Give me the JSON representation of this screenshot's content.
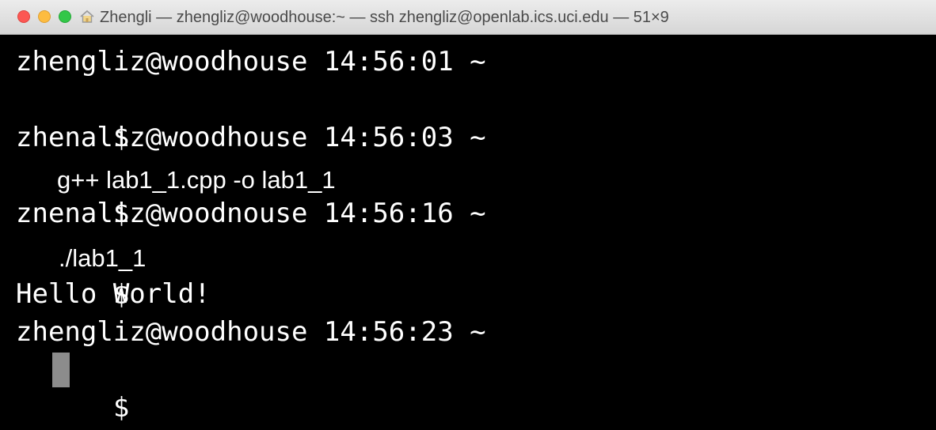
{
  "window": {
    "title": "Zhengli — zhengliz@woodhouse:~ — ssh zhengliz@openlab.ics.uci.edu — 51×9",
    "title_icon": "home-icon",
    "colors": {
      "background": "#000000",
      "foreground": "#ffffff",
      "cursor": "#8c8c8c",
      "close": "#fc5753",
      "minimize": "#fdbc40",
      "maximize": "#33c748"
    }
  },
  "terminal": {
    "lines": [
      {
        "kind": "prompt",
        "text": "zhengliz@woodhouse 14:56:01 ~"
      },
      {
        "kind": "input",
        "text": "$",
        "command": ""
      },
      {
        "kind": "prompt",
        "text": "zhenaliz@woodhouse 14:56:03 ~"
      },
      {
        "kind": "input",
        "text": "$",
        "command": "g++ lab1_1.cpp -o lab1_1"
      },
      {
        "kind": "prompt",
        "text": "znenaliz@woodnouse 14:56:16 ~"
      },
      {
        "kind": "input",
        "text": "$",
        "command": "./lab1_1"
      },
      {
        "kind": "output",
        "text": "Hello World!"
      },
      {
        "kind": "prompt",
        "text": "zhengliz@woodhouse 14:56:23 ~"
      },
      {
        "kind": "input",
        "text": "$",
        "command": ""
      }
    ]
  }
}
